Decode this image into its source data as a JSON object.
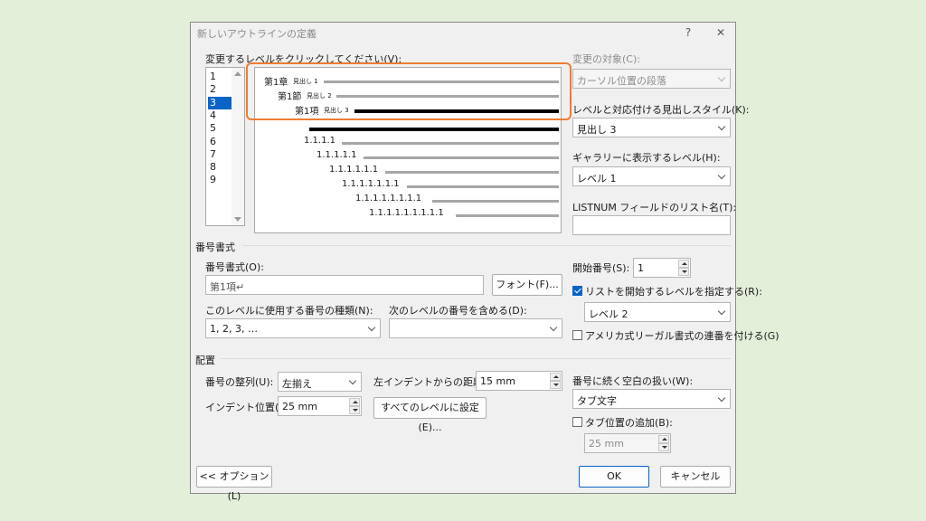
{
  "dialog": {
    "title": "新しいアウトラインの定義",
    "help": "?",
    "close": "✕"
  },
  "level_select": {
    "label": "変更するレベルをクリックしてください(V):",
    "levels": [
      "1",
      "2",
      "3",
      "4",
      "5",
      "6",
      "7",
      "8",
      "9"
    ],
    "selected": "3"
  },
  "preview": {
    "rows": [
      {
        "main": "第1章",
        "small": "見出し 1"
      },
      {
        "main": "第1節",
        "small": "見出し 2"
      },
      {
        "main": "第1項",
        "small": "見出し 3"
      },
      {
        "main": ""
      },
      {
        "main": "1.1.1.1"
      },
      {
        "main": "1.1.1.1.1"
      },
      {
        "main": "1.1.1.1.1.1"
      },
      {
        "main": "1.1.1.1.1.1.1"
      },
      {
        "main": "1.1.1.1.1.1.1.1"
      },
      {
        "main": "1.1.1.1.1.1.1.1.1"
      }
    ]
  },
  "right_panel": {
    "apply_to_label": "変更の対象(C):",
    "apply_to_value": "カーソル位置の段落",
    "link_style_label": "レベルと対応付ける見出しスタイル(K):",
    "link_style_value": "見出し 3",
    "gallery_level_label": "ギャラリーに表示するレベル(H):",
    "gallery_level_value": "レベル 1",
    "listnum_label": "LISTNUM フィールドのリスト名(T):",
    "listnum_value": ""
  },
  "number_format": {
    "section": "番号書式",
    "format_label": "番号書式(O):",
    "format_value": "第1項↵",
    "font_button": "フォント(F)...",
    "style_label": "このレベルに使用する番号の種類(N):",
    "style_value": "1, 2, 3, …",
    "include_label": "次のレベルの番号を含める(D):",
    "include_value": "",
    "start_label": "開始番号(S):",
    "start_value": "1",
    "restart_label": "リストを開始するレベルを指定する(R):",
    "restart_checked": true,
    "restart_value": "レベル 2",
    "legal_label": "アメリカ式リーガル書式の連番を付ける(G)",
    "legal_checked": false
  },
  "position": {
    "section": "配置",
    "align_label": "番号の整列(U):",
    "align_value": "左揃え",
    "align_at_label": "左インデントからの距離(A):",
    "align_at_value": "15 mm",
    "indent_label": "インデント位置(I):",
    "indent_value": "25 mm",
    "set_all_button": "すべてのレベルに設定(E)...",
    "follow_label": "番号に続く空白の扱い(W):",
    "follow_value": "タブ文字",
    "tab_add_label": "タブ位置の追加(B):",
    "tab_add_checked": false,
    "tab_add_value": "25 mm"
  },
  "footer": {
    "options_button": "<< オプション(L)",
    "ok_button": "OK",
    "cancel_button": "キャンセル"
  },
  "colors": {
    "highlight": "#ed7d31",
    "selection": "#0a64c8"
  }
}
